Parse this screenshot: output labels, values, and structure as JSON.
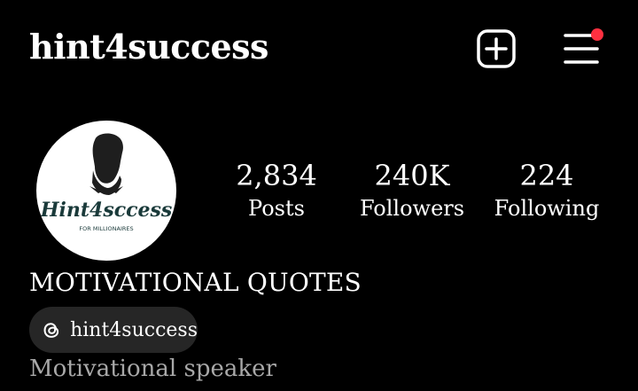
{
  "header": {
    "username": "hint4success",
    "add_icon": "plus-square-icon",
    "menu_icon": "hamburger-menu-icon",
    "notification_dot_color": "#ff3040"
  },
  "profile": {
    "avatar": {
      "brand_text": "Hint4sccess",
      "tagline": "FOR MILLIONAIRES"
    },
    "stats": [
      {
        "value": "2,834",
        "label": "Posts"
      },
      {
        "value": "240K",
        "label": "Followers"
      },
      {
        "value": "224",
        "label": "Following"
      }
    ],
    "category": "MOTIVATIONAL QUOTES",
    "threads": {
      "icon": "threads-icon",
      "handle": "hint4success"
    },
    "bio": "Motivational speaker"
  }
}
